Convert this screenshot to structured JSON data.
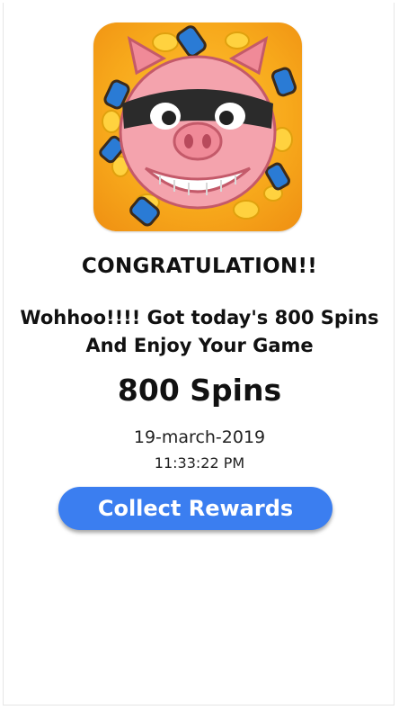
{
  "reward": {
    "heading": "CONGRATULATION!!",
    "message": "Wohhoo!!!! Got today's 800 Spins And Enjoy Your Game",
    "amount": "800 Spins",
    "date": "19-march-2019",
    "time": "11:33:22 PM",
    "collect_label": "Collect Rewards"
  },
  "icon": {
    "name": "pig-bandit-app-icon",
    "colors": {
      "background": "#f7a81b",
      "pig": "#f4a3ad",
      "mask": "#2b2b2b",
      "coin": "#ffd23f",
      "spin_capsule": "#2a7bd5"
    }
  },
  "colors": {
    "button": "#3b7ef0",
    "button_text": "#ffffff",
    "text": "#111111"
  }
}
